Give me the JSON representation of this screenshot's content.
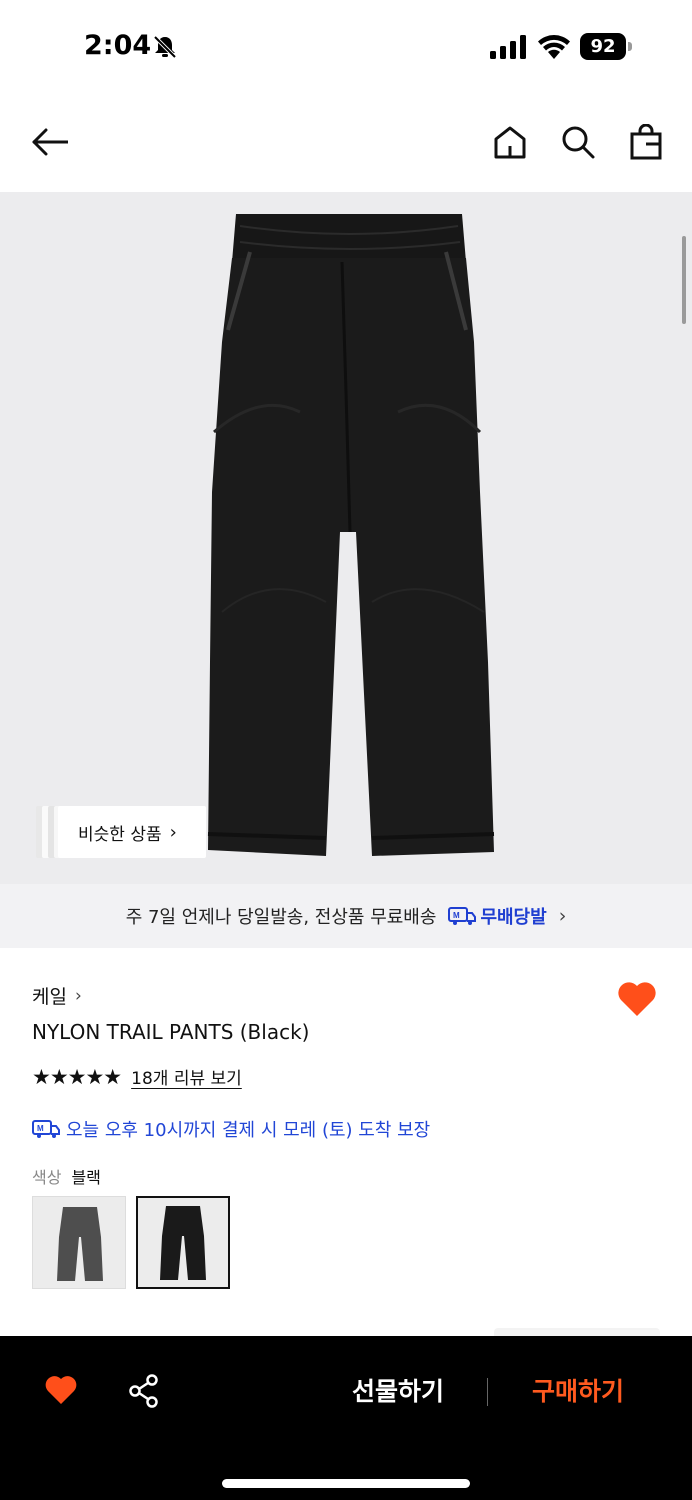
{
  "status_bar": {
    "time": "2:04",
    "battery": "92",
    "icons": [
      "bell-slash-icon",
      "signal-icon",
      "wifi-icon",
      "battery-icon"
    ]
  },
  "header": {
    "icons": [
      "back-arrow-icon",
      "home-icon",
      "search-icon",
      "shopping-bag-icon"
    ]
  },
  "hero": {
    "similar_products_label": "비슷한 상품",
    "similar_products_chevron": "›"
  },
  "delivery_banner": {
    "text": "주 7일 언제나 당일발송, 전상품 무료배송",
    "brand": "무배당발",
    "chevron": "›"
  },
  "product": {
    "brand": "케일",
    "brand_chevron": "›",
    "name": "NYLON TRAIL PANTS (Black)",
    "rating_stars": "★★★★★",
    "rating_value": 5,
    "reviews_link": "18개 리뷰 보기",
    "delivery_promise": "오늘 오후 10시까지 결제 시 모레 (토) 도착 보장",
    "color_label": "색상",
    "color_value": "블랙",
    "swatches": [
      "grey",
      "black"
    ],
    "selected_swatch_index": 1
  },
  "bottom_bar": {
    "gift_label": "선물하기",
    "buy_label": "구매하기"
  },
  "colors": {
    "accent_orange": "#ff5a1f",
    "link_blue": "#2146d6",
    "banner_bg": "#f2f2f4",
    "hero_bg": "#ececee"
  }
}
